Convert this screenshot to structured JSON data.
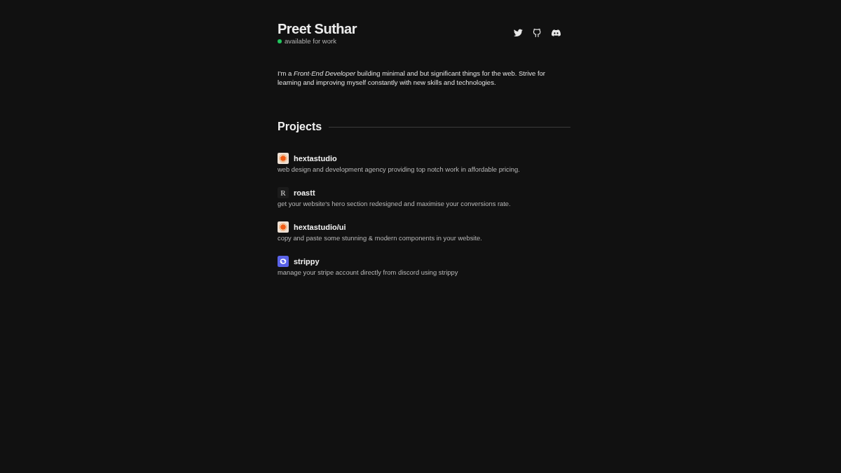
{
  "header": {
    "name": "Preet Suthar",
    "status": {
      "label": "available for work",
      "available": true
    },
    "social_links": [
      {
        "kind": "twitter"
      },
      {
        "kind": "github"
      },
      {
        "kind": "discord"
      }
    ]
  },
  "bio": "I'm a *Front-End Developer* building minimal and but significant things for the web. Strive for learning and improving myself constantly with new skills and technologies.",
  "projects": {
    "heading": "Projects",
    "items": [
      {
        "kind": "sunburst",
        "name": "hextastudio",
        "description": "web design and development agency providing top notch work in affordable pricing."
      },
      {
        "kind": "letter",
        "logo_text": "R",
        "name": "roastt",
        "description": "get your website's hero section redesigned and maximise your conversions rate."
      },
      {
        "kind": "sunburst",
        "name": "hextastudio/ui",
        "description": "copy and paste some stunning & modern components in your website."
      },
      {
        "kind": "app",
        "name": "strippy",
        "description": "manage your stripe account directly from discord using strippy"
      }
    ]
  }
}
